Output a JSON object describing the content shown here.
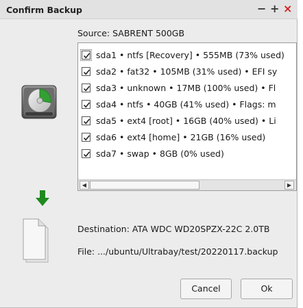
{
  "window": {
    "title": "Confirm Backup",
    "minimize_glyph": "−",
    "maximize_glyph": "+",
    "close_glyph": "×"
  },
  "source_label": "Source:  SABRENT  500GB",
  "partitions": [
    {
      "text": "sda1 • ntfs [Recovery] • 555MB (73% used)",
      "checked": true
    },
    {
      "text": "sda2 • fat32 • 105MB (31% used) • EFI sy",
      "checked": true
    },
    {
      "text": "sda3 • unknown • 17MB (100% used) • Fl",
      "checked": true
    },
    {
      "text": "sda4 • ntfs • 40GB (41% used) • Flags: m",
      "checked": true
    },
    {
      "text": "sda5 • ext4 [root] • 16GB (40% used) • Li",
      "checked": true
    },
    {
      "text": "sda6 • ext4 [home] • 21GB (16% used)",
      "checked": true
    },
    {
      "text": "sda7 • swap • 8GB (0% used)",
      "checked": true
    }
  ],
  "scrollbar": {
    "left_arrow": "◀",
    "right_arrow": "▶"
  },
  "destination_label": "Destination:  ATA WDC WD20SPZX-22C 2.0TB",
  "file_label": "File:  .../ubuntu/Ultrabay/test/20220117.backup",
  "buttons": {
    "cancel": "Cancel",
    "ok": "Ok"
  },
  "icons": {
    "drive": "hard-drive-icon",
    "arrow": "down-arrow-icon",
    "file": "document-icon",
    "arrow_color": "#1f8a1f",
    "close_color": "#d82020"
  }
}
